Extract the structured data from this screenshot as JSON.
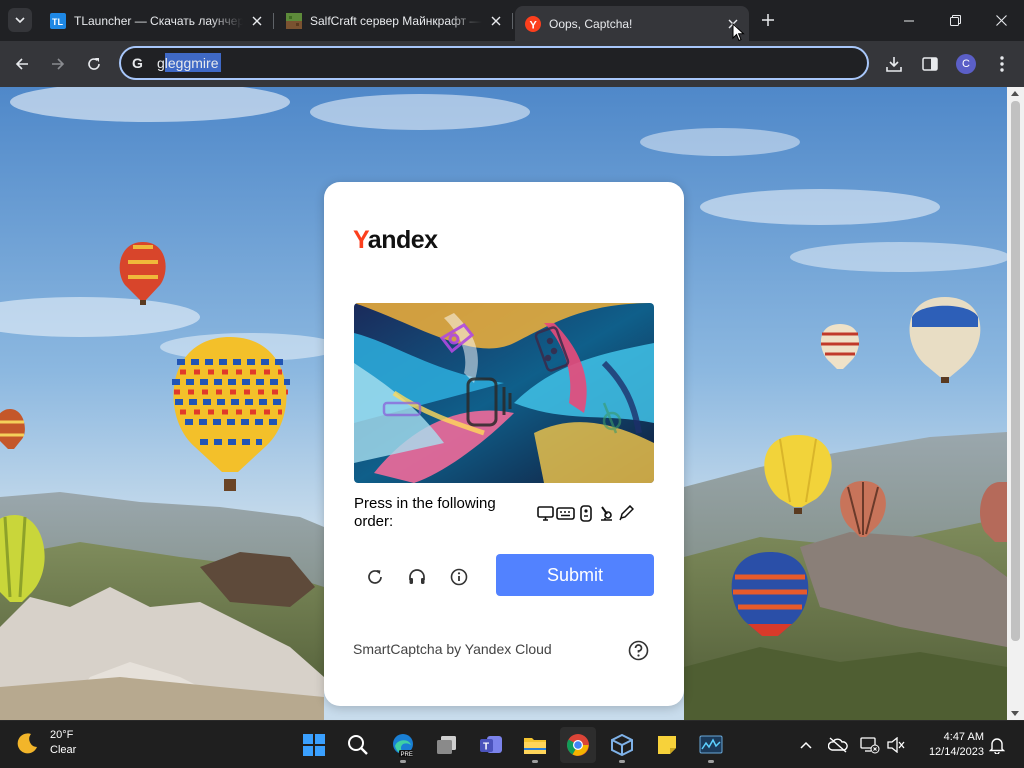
{
  "browser": {
    "tabs": [
      {
        "title": "TLauncher — Скачать лаунчер",
        "icon": "tlauncher-icon",
        "active": false
      },
      {
        "title": "SalfCraft сервер Майнкрафт —",
        "icon": "minecraft-icon",
        "active": false
      },
      {
        "title": "Oops, Captcha!",
        "icon": "yandex-icon",
        "active": true
      }
    ],
    "address": "gleggmire"
  },
  "captcha": {
    "brand": {
      "y": "Y",
      "rest": "andex"
    },
    "instruction": "Press in the following order:",
    "order_icons": [
      "monitor-icon",
      "keyboard-icon",
      "remote-icon",
      "microscope-icon",
      "pencil-icon"
    ],
    "submit_label": "Submit",
    "footer": "SmartCaptcha by Yandex Cloud",
    "colors": {
      "submit": "#5282ff",
      "brand_red": "#fc3f1d"
    }
  },
  "taskbar": {
    "weather": {
      "temp": "20°F",
      "condition": "Clear"
    },
    "pinned_apps": [
      "windows-start-icon",
      "search-icon",
      "edge-pre-icon",
      "task-view-icon",
      "teams-icon",
      "file-explorer-icon",
      "chrome-icon",
      "virtualbox-icon",
      "sticky-notes-icon",
      "resource-monitor-icon"
    ],
    "time": "4:47 AM",
    "date": "12/14/2023"
  }
}
